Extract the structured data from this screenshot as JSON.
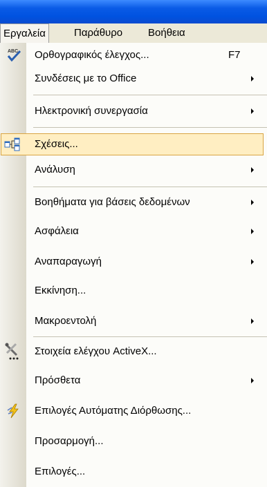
{
  "menubar": {
    "items": [
      "Εργαλεία",
      "Παράθυρο",
      "Βοήθεια"
    ],
    "open_item": "Εργαλεία"
  },
  "menu": {
    "items": [
      {
        "label": "Ορθογραφικός έλεγχος...",
        "shortcut": "F7",
        "submenu": false,
        "icon": "spelling-abc-icon"
      },
      {
        "label": "Συνδέσεις με το Office",
        "submenu": true
      },
      {
        "label": "Ηλεκτρονική συνεργασία",
        "submenu": true
      },
      {
        "label": "Σχέσεις...",
        "submenu": false,
        "selected": true,
        "icon": "relationships-icon"
      },
      {
        "label": "Ανάλυση",
        "submenu": true
      },
      {
        "label": "Βοηθήματα για βάσεις δεδομένων",
        "submenu": true
      },
      {
        "label": "Ασφάλεια",
        "submenu": true
      },
      {
        "label": "Αναπαραγωγή",
        "submenu": true
      },
      {
        "label": "Εκκίνηση...",
        "submenu": false
      },
      {
        "label": "Μακροεντολή",
        "submenu": true
      },
      {
        "label": "Στοιχεία ελέγχου ActiveX...",
        "submenu": false,
        "icon": "activex-tools-icon"
      },
      {
        "label": "Πρόσθετα",
        "submenu": true
      },
      {
        "label": "Επιλογές Αυτόματης Διόρθωσης...",
        "submenu": false,
        "icon": "autocorrect-lightning-icon"
      },
      {
        "label": "Προσαρμογή...",
        "submenu": false
      },
      {
        "label": "Επιλογές...",
        "submenu": false
      }
    ]
  },
  "colors": {
    "titlebar": "#0a5be6",
    "menubar": "#ece9d8",
    "highlight_fill": "#ffeec2",
    "highlight_border": "#d9a441"
  }
}
